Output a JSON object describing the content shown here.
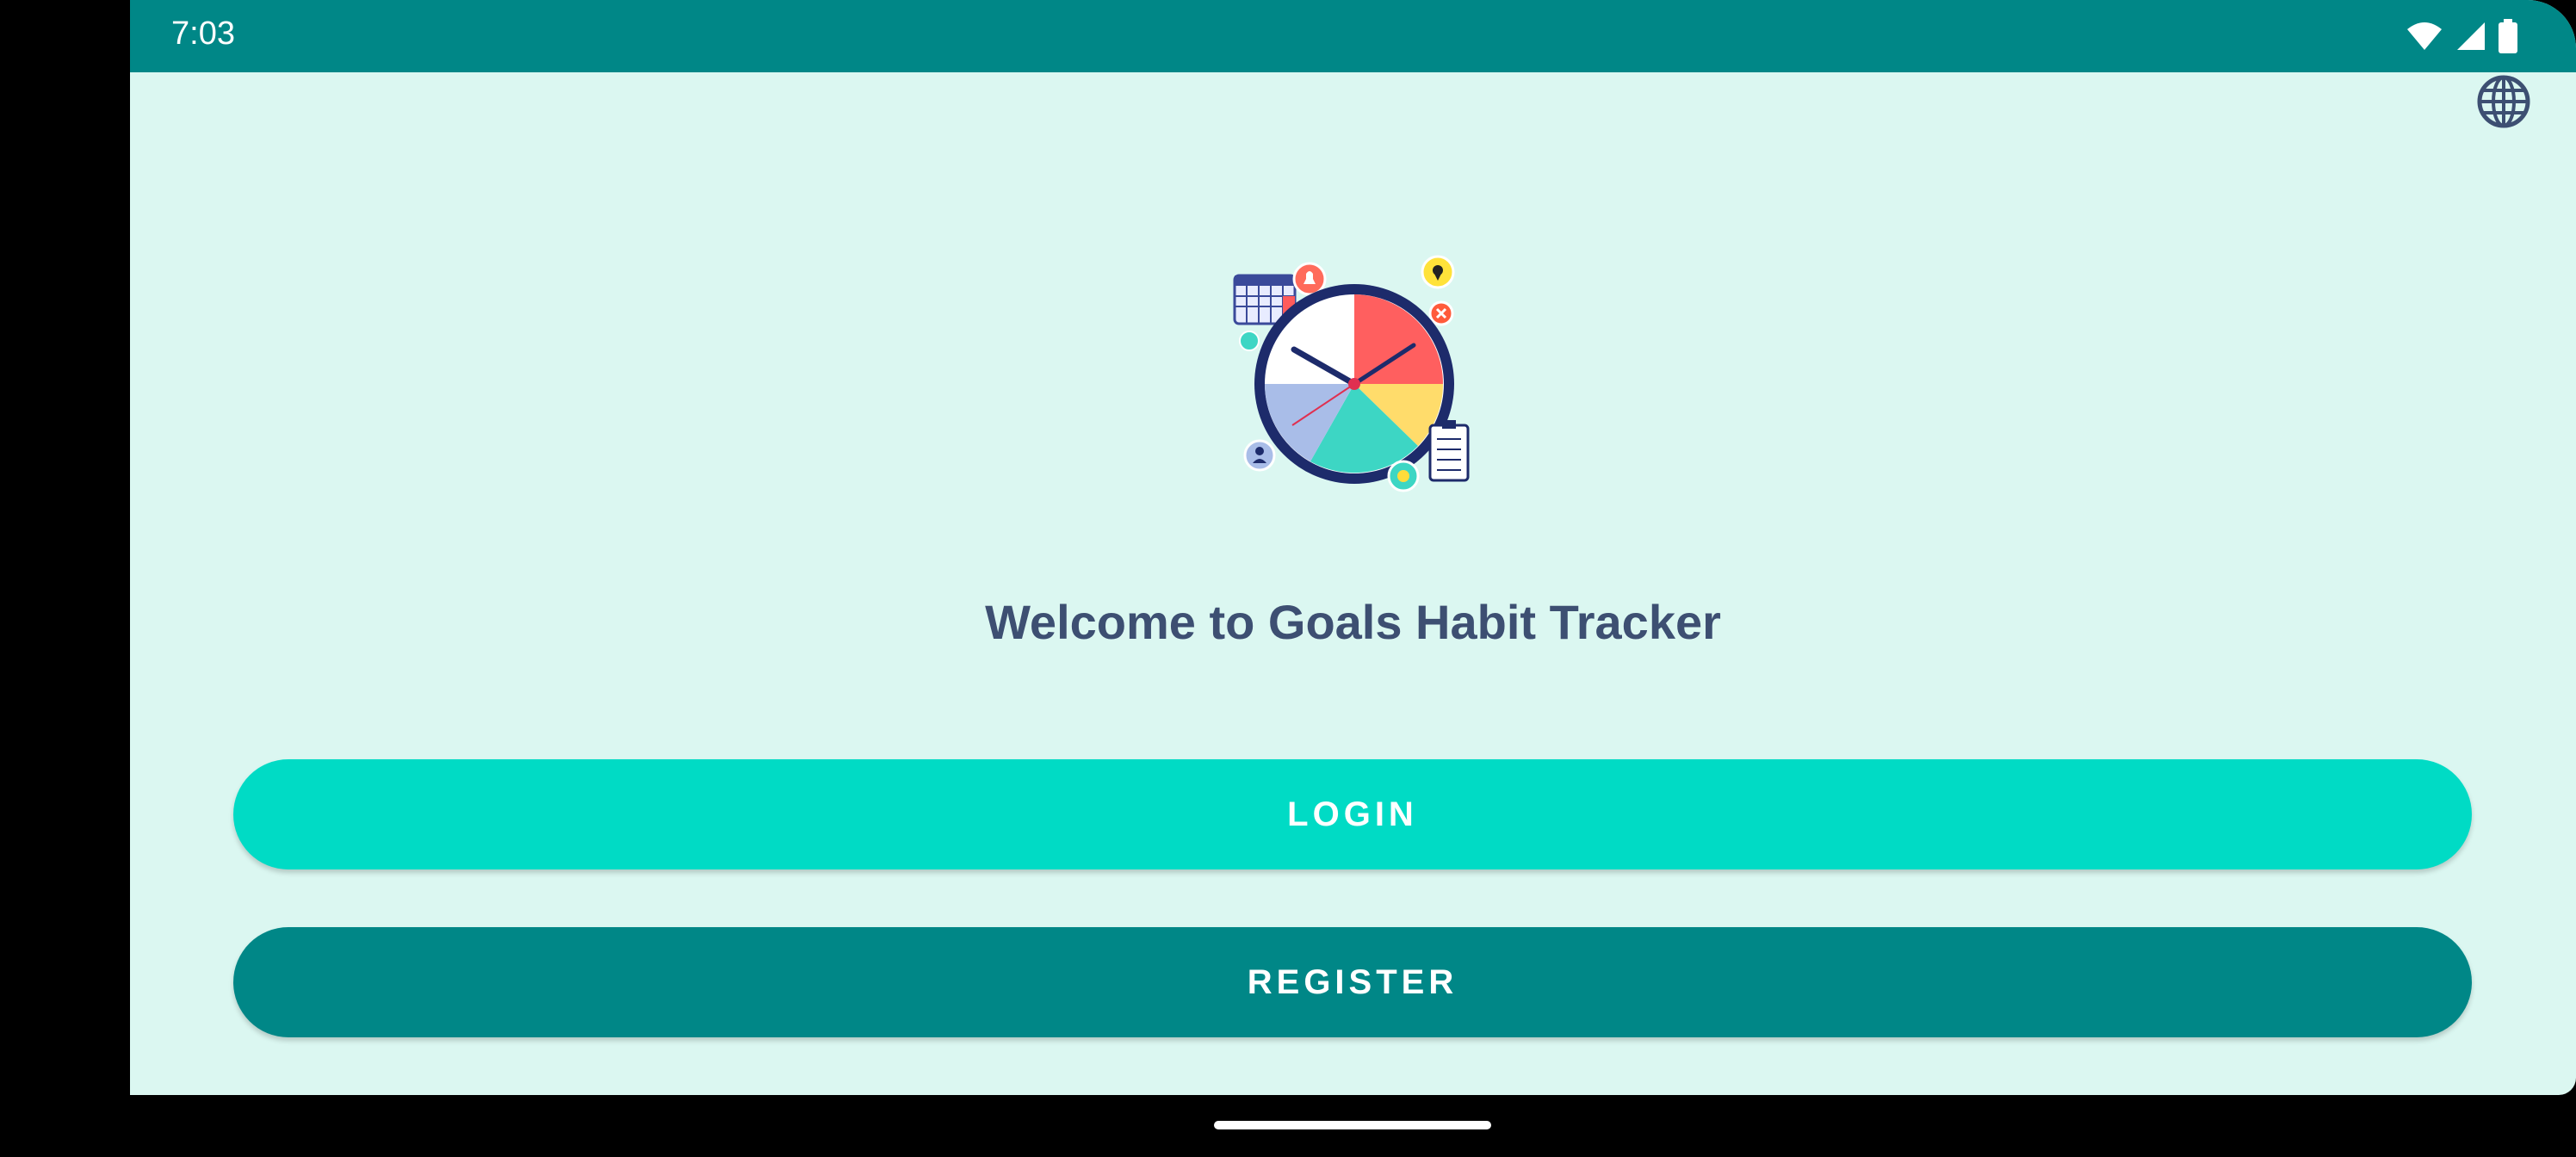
{
  "status_bar": {
    "time": "7:03",
    "icons": [
      "wifi-icon",
      "signal-icon",
      "battery-icon"
    ]
  },
  "header": {
    "language_icon": "globe-icon"
  },
  "logo": {
    "icon": "habit-clock-illustration"
  },
  "main": {
    "welcome_text": "Welcome to Goals Habit Tracker",
    "login_label": "LOGIN",
    "register_label": "REGISTER"
  },
  "colors": {
    "status_bar": "#008787",
    "background": "#dbf7f1",
    "login_button": "#00dbc5",
    "register_button": "#008787",
    "title_text": "#3d4f72"
  }
}
